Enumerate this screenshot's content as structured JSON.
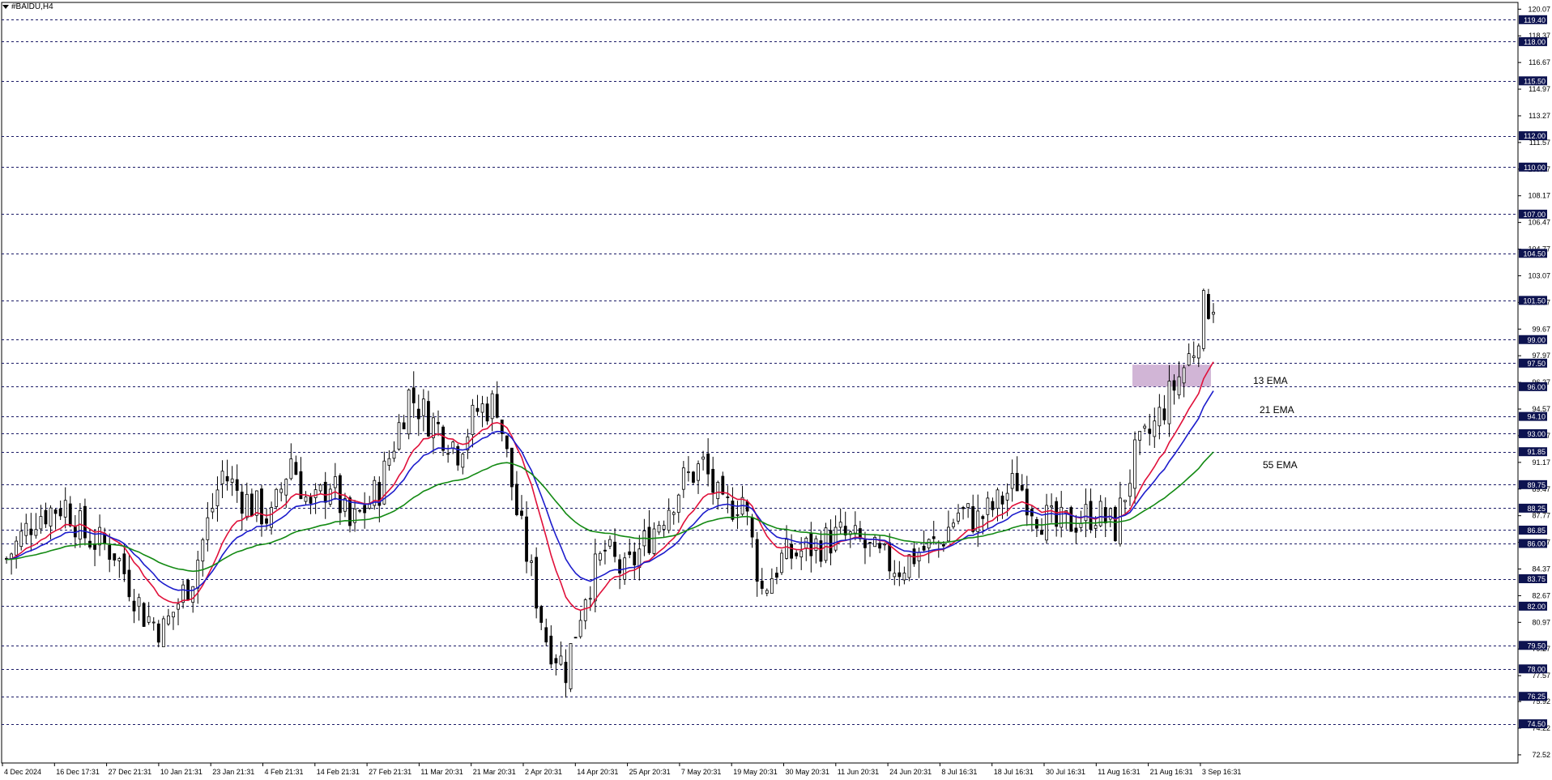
{
  "window": {
    "symbol_title": "#BAIDU,H4"
  },
  "colors": {
    "ema13": "#e0103a",
    "ema21": "#1c1ccc",
    "ema55": "#138a13",
    "candle": "#000000",
    "level_line": "#1a1a66",
    "level_tag_bg": "#0d1350",
    "level_tag_text": "#ffffff",
    "zone_fill": "#c9a8cf"
  },
  "chart_data": {
    "type": "candlestick",
    "symbol": "#BAIDU",
    "timeframe": "H4",
    "ylim": [
      72.0,
      120.5
    ],
    "y_ticks": [
      "120.07",
      "118.37",
      "116.67",
      "114.97",
      "113.27",
      "111.57",
      "109.87",
      "108.17",
      "106.47",
      "104.77",
      "103.07",
      "101.37",
      "99.67",
      "97.97",
      "96.27",
      "94.57",
      "92.87",
      "91.17",
      "89.47",
      "87.77",
      "86.07",
      "84.37",
      "82.67",
      "80.97",
      "79.27",
      "77.57",
      "75.92",
      "74.22",
      "72.52"
    ],
    "x_ticks": [
      "4 Dec 2024",
      "16 Dec 17:31",
      "27 Dec 21:31",
      "10 Jan 21:31",
      "23 Jan 21:31",
      "4 Feb 21:31",
      "14 Feb 21:31",
      "27 Feb 21:31",
      "11 Mar 20:31",
      "21 Mar 20:31",
      "2 Apr 20:31",
      "14 Apr 20:31",
      "25 Apr 20:31",
      "7 May 20:31",
      "19 May 20:31",
      "30 May 20:31",
      "11 Jun 20:31",
      "24 Jun 20:31",
      "8 Jul 16:31",
      "18 Jul 16:31",
      "30 Jul 16:31",
      "11 Aug 16:31",
      "21 Aug 16:31",
      "3 Sep 16:31"
    ],
    "levels": [
      "119.40",
      "118.00",
      "115.50",
      "112.00",
      "110.00",
      "107.00",
      "104.50",
      "101.50",
      "99.00",
      "97.50",
      "96.00",
      "94.10",
      "93.00",
      "91.85",
      "89.75",
      "88.25",
      "86.85",
      "86.00",
      "83.75",
      "82.00",
      "79.50",
      "78.00",
      "76.25",
      "74.50"
    ],
    "zone": {
      "low": 96.0,
      "high": 97.4,
      "from_bar": 230,
      "to_bar": 246
    },
    "series": [
      {
        "name": "13 EMA",
        "period": 13
      },
      {
        "name": "21 EMA",
        "period": 21
      },
      {
        "name": "55 EMA",
        "period": 55
      }
    ],
    "price_path": [
      [
        0,
        85.0
      ],
      [
        6,
        87.8
      ],
      [
        12,
        88.5
      ],
      [
        16,
        86.5
      ],
      [
        22,
        85.5
      ],
      [
        28,
        81.5
      ],
      [
        32,
        80.5
      ],
      [
        38,
        84.0
      ],
      [
        44,
        90.5
      ],
      [
        48,
        89.0
      ],
      [
        54,
        87.5
      ],
      [
        58,
        91.5
      ],
      [
        62,
        88.0
      ],
      [
        66,
        90.0
      ],
      [
        70,
        87.0
      ],
      [
        76,
        89.5
      ],
      [
        82,
        95.5
      ],
      [
        86,
        94.0
      ],
      [
        90,
        92.8
      ],
      [
        92,
        92.0
      ],
      [
        96,
        94.5
      ],
      [
        100,
        95.0
      ],
      [
        104,
        88.0
      ],
      [
        110,
        80.0
      ],
      [
        114,
        78.0
      ],
      [
        118,
        83.0
      ],
      [
        122,
        85.5
      ],
      [
        126,
        84.0
      ],
      [
        130,
        86.0
      ],
      [
        134,
        88.0
      ],
      [
        138,
        90.0
      ],
      [
        142,
        91.0
      ],
      [
        146,
        88.0
      ],
      [
        150,
        89.0
      ],
      [
        154,
        83.0
      ],
      [
        158,
        85.0
      ],
      [
        162,
        85.5
      ],
      [
        166,
        86.0
      ],
      [
        170,
        86.5
      ],
      [
        174,
        86.0
      ],
      [
        178,
        85.0
      ],
      [
        182,
        84.5
      ],
      [
        186,
        85.5
      ],
      [
        190,
        86.0
      ],
      [
        194,
        88.0
      ],
      [
        198,
        87.5
      ],
      [
        202,
        88.5
      ],
      [
        206,
        90.0
      ],
      [
        210,
        88.0
      ],
      [
        214,
        87.0
      ],
      [
        218,
        87.5
      ],
      [
        222,
        88.0
      ],
      [
        226,
        87.0
      ],
      [
        230,
        91.5
      ],
      [
        234,
        93.5
      ],
      [
        238,
        96.0
      ],
      [
        242,
        98.5
      ],
      [
        244,
        101.0
      ],
      [
        246,
        101.5
      ]
    ],
    "bar_count": 247,
    "last_close": 101.5
  },
  "ema_labels": {
    "ema13": "13 EMA",
    "ema21": "21 EMA",
    "ema55": "55 EMA"
  }
}
